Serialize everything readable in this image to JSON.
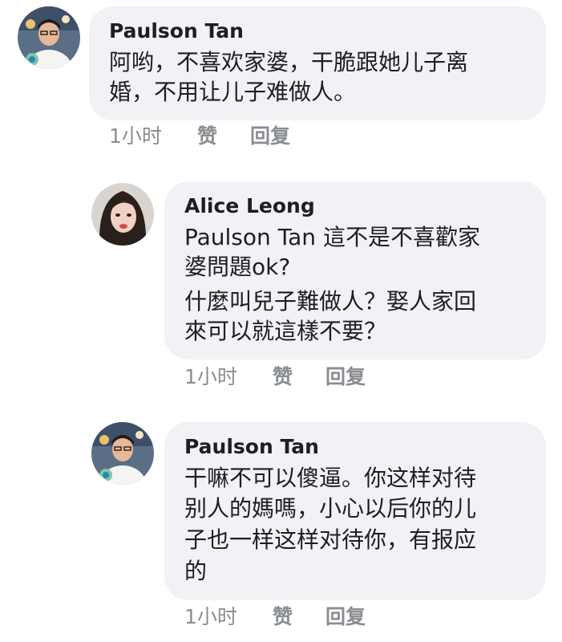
{
  "comments": [
    {
      "author": "Paulson Tan",
      "lines": [
        "阿哟，不喜欢家婆，干脆跟她儿子离",
        "婚，不用让儿子难做人。"
      ],
      "time": "1小时",
      "like": "赞",
      "reply": "回复"
    },
    {
      "author": "Alice Leong",
      "mention": "Paulson Tan",
      "lines": [
        " 這不是不喜歡家",
        "婆問題ok?",
        "什麼叫兒子難做人？娶人家回",
        "來可以就這樣不要？"
      ],
      "time": "1小时",
      "like": "赞",
      "reply": "回复"
    },
    {
      "author": "Paulson Tan",
      "lines": [
        "干嘛不可以傻逼。你这样对待",
        "别人的媽嗎，小心以后你的儿",
        "子也一样这样对待你，有报应",
        "的"
      ],
      "time": "1小时",
      "like": "赞",
      "reply": "回复"
    }
  ],
  "colors": {
    "bubble": "#f0f2f5",
    "text": "#1c1e21",
    "meta": "#8a8d91"
  }
}
